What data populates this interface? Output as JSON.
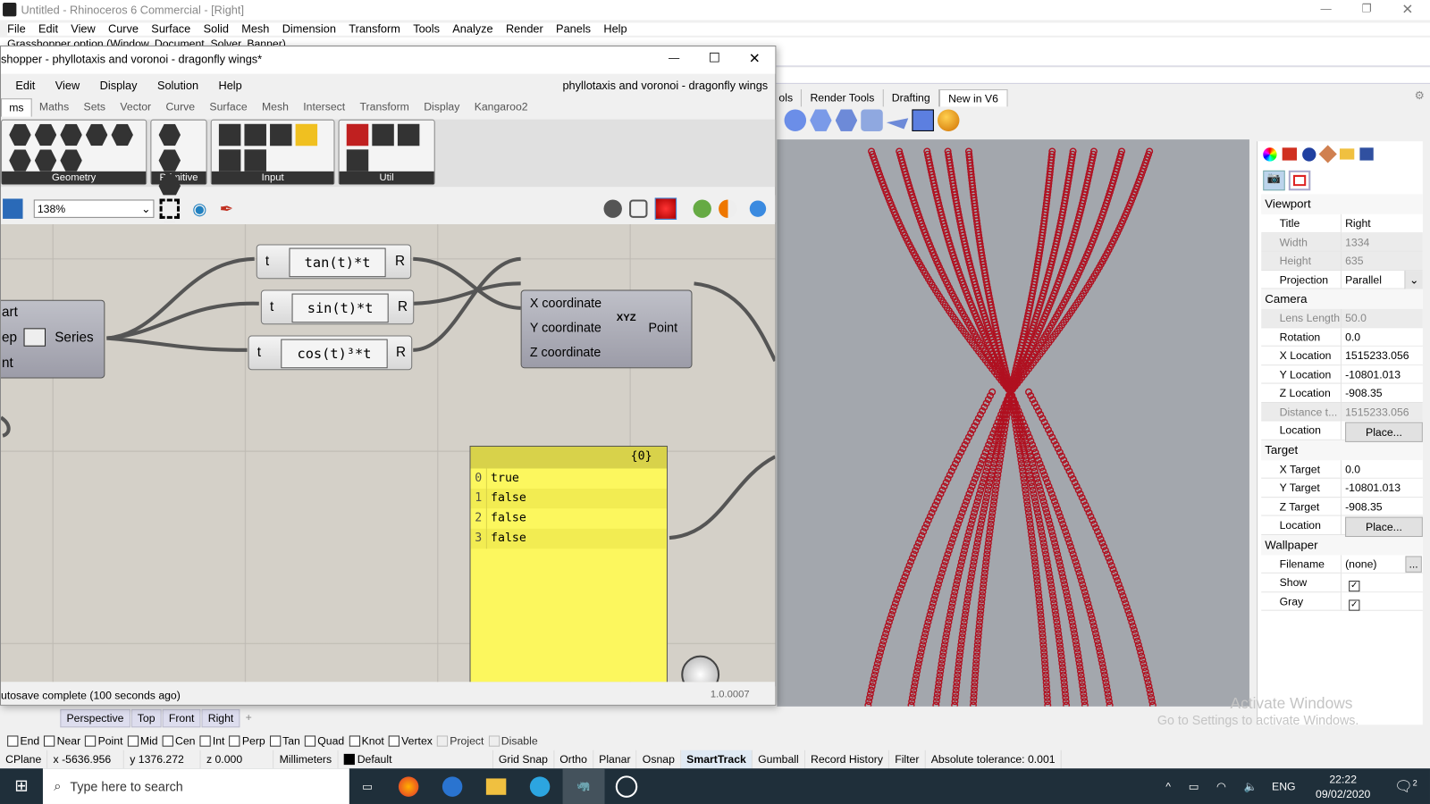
{
  "rhino": {
    "title": "Untitled - Rhinoceros 6 Commercial - [Right]",
    "menu": [
      "File",
      "Edit",
      "View",
      "Curve",
      "Surface",
      "Solid",
      "Mesh",
      "Dimension",
      "Transform",
      "Tools",
      "Analyze",
      "Render",
      "Panels",
      "Help"
    ],
    "command_hint": "Grasshopper option (Window, Document, Solver, Banner)",
    "toolbar_tabs": [
      "ols",
      "Render Tools",
      "Drafting",
      "New in V6"
    ],
    "viewport_tabs": [
      "Perspective",
      "Top",
      "Front",
      "Right"
    ],
    "osnaps": [
      {
        "label": "End",
        "checked": false
      },
      {
        "label": "Near",
        "checked": false
      },
      {
        "label": "Point",
        "checked": false
      },
      {
        "label": "Mid",
        "checked": false
      },
      {
        "label": "Cen",
        "checked": false
      },
      {
        "label": "Int",
        "checked": false
      },
      {
        "label": "Perp",
        "checked": false
      },
      {
        "label": "Tan",
        "checked": false
      },
      {
        "label": "Quad",
        "checked": false
      },
      {
        "label": "Knot",
        "checked": false
      },
      {
        "label": "Vertex",
        "checked": false
      },
      {
        "label": "Project",
        "checked": false
      },
      {
        "label": "Disable",
        "checked": false
      }
    ],
    "status": {
      "cplane": "CPlane",
      "x": "x -5636.956",
      "y": "y 1376.272",
      "z": "z 0.000",
      "units": "Millimeters",
      "layer": "Default",
      "toggles": [
        "Grid Snap",
        "Ortho",
        "Planar",
        "Osnap",
        "SmartTrack",
        "Gumball",
        "Record History",
        "Filter"
      ],
      "tolerance": "Absolute tolerance: 0.001"
    },
    "watermark": {
      "line1": "Activate Windows",
      "line2": "Go to Settings to activate Windows."
    }
  },
  "gh": {
    "title": "shopper - phyllotaxis and voronoi - dragonfly wings*",
    "doc_name": "phyllotaxis and voronoi - dragonfly wings",
    "menu": [
      "Edit",
      "View",
      "Display",
      "Solution",
      "Help"
    ],
    "tabs": [
      "ms",
      "Maths",
      "Sets",
      "Vector",
      "Curve",
      "Surface",
      "Mesh",
      "Intersect",
      "Transform",
      "Display",
      "Kangaroo2"
    ],
    "groups": [
      "Geometry",
      "Primitive",
      "Input",
      "Util"
    ],
    "zoom": "138%",
    "series": {
      "inputs": [
        "art",
        "ep",
        "nt"
      ],
      "output": "Series"
    },
    "exprs": [
      {
        "in": "t",
        "expr": "tan(t)*t",
        "out": "R"
      },
      {
        "in": "t",
        "expr": "sin(t)*t",
        "out": "R"
      },
      {
        "in": "t",
        "expr": "cos(t)³*t",
        "out": "R"
      }
    ],
    "point": {
      "inputs": [
        "X coordinate",
        "Y coordinate",
        "Z coordinate"
      ],
      "icon_text": "XYZ",
      "output": "Point"
    },
    "panel": {
      "path": "{0}",
      "rows": [
        {
          "i": "0",
          "v": "true"
        },
        {
          "i": "1",
          "v": "false"
        },
        {
          "i": "2",
          "v": "false"
        },
        {
          "i": "3",
          "v": "false"
        }
      ]
    },
    "status": "utosave complete (100 seconds ago)",
    "version": "1.0.0007"
  },
  "properties": {
    "sections": [
      {
        "title": "Viewport",
        "rows": [
          {
            "k": "Title",
            "v": "Right"
          },
          {
            "k": "Width",
            "v": "1334",
            "ro": true
          },
          {
            "k": "Height",
            "v": "635",
            "ro": true
          },
          {
            "k": "Projection",
            "v": "Parallel",
            "dd": true
          }
        ]
      },
      {
        "title": "Camera",
        "rows": [
          {
            "k": "Lens Length",
            "v": "50.0",
            "ro": true
          },
          {
            "k": "Rotation",
            "v": "0.0"
          },
          {
            "k": "X Location",
            "v": "1515233.056"
          },
          {
            "k": "Y Location",
            "v": "-10801.013"
          },
          {
            "k": "Z Location",
            "v": "-908.35"
          },
          {
            "k": "Distance t...",
            "v": "1515233.056",
            "ro": true
          },
          {
            "k": "Location",
            "v": "Place...",
            "btn": true
          }
        ]
      },
      {
        "title": "Target",
        "rows": [
          {
            "k": "X Target",
            "v": "0.0"
          },
          {
            "k": "Y Target",
            "v": "-10801.013"
          },
          {
            "k": "Z Target",
            "v": "-908.35"
          },
          {
            "k": "Location",
            "v": "Place...",
            "btn": true
          }
        ]
      },
      {
        "title": "Wallpaper",
        "rows": [
          {
            "k": "Filename",
            "v": "(none)",
            "more": "..."
          },
          {
            "k": "Show",
            "check": true
          },
          {
            "k": "Gray",
            "check": true
          }
        ]
      }
    ]
  },
  "taskbar": {
    "search_placeholder": "Type here to search",
    "time": "22:22",
    "date": "09/02/2020",
    "lang": "ENG",
    "notif": "2"
  },
  "colors": {
    "viewport_bg": "#a3a7ad",
    "curve": "#b01020",
    "panel": "#fcf75e",
    "canvas": "#d4d0c8",
    "taskbar": "#1f2f3a"
  }
}
